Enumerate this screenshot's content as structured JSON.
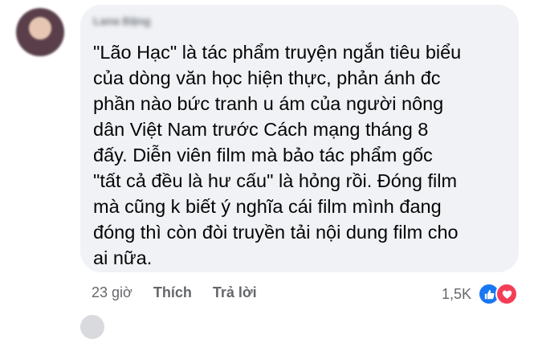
{
  "comment": {
    "author": "Lana Đặng",
    "text": "\"Lão Hạc\" là tác phẩm truyện ngắn tiêu biểu\ncủa dòng văn học hiện thực, phản ánh đc\nphần nào bức tranh u ám của người nông\ndân Việt Nam trước Cách mạng tháng 8\nđấy. Diễn viên film mà bảo tác phẩm gốc\n\"tất cả đều là hư cấu\" là hỏng rồi. Đóng film\nmà cũng k biết ý nghĩa cái film mình đang\nđóng thì còn đòi truyền tải nội dung film cho\nai nữa.",
    "time": "23 giờ",
    "like_label": "Thích",
    "reply_label": "Trả lời",
    "reaction_count": "1,5K",
    "reaction_icons": [
      "like-icon",
      "love-icon"
    ],
    "colors": {
      "bubble": "#f0f2f5",
      "meta_text": "#65676b",
      "like": "#1877f2",
      "love": "#f33e58"
    }
  }
}
